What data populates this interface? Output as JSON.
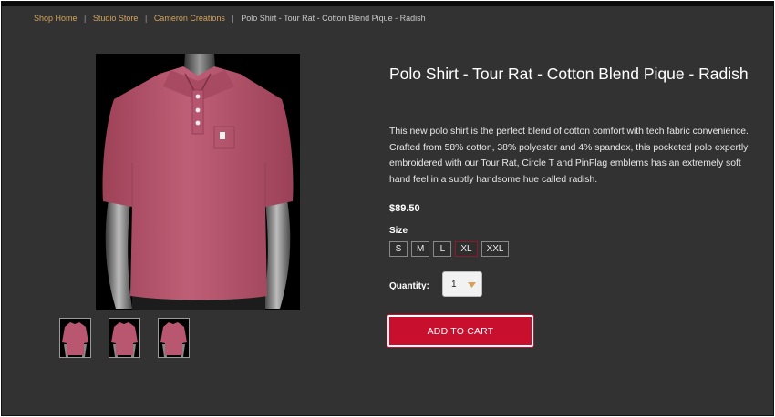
{
  "breadcrumb": {
    "items": [
      "Shop Home",
      "Studio Store",
      "Cameron Creations"
    ],
    "separator": "|",
    "current": "Polo Shirt - Tour Rat - Cotton Blend Pique - Radish"
  },
  "product": {
    "title": "Polo Shirt - Tour Rat - Cotton Blend Pique - Radish",
    "description": "This new polo shirt is the perfect blend of cotton comfort with tech fabric convenience. Crafted from 58% cotton, 38% polyester and 4% spandex, this pocketed polo expertly embroidered with our Tour Rat, Circle T and PinFlag emblems has an extremely soft hand feel in a subtly handsome hue called radish.",
    "price": "$89.50",
    "size_label": "Size",
    "sizes": [
      "S",
      "M",
      "L",
      "XL",
      "XXL"
    ],
    "quantity_label": "Quantity:",
    "quantity_value": "1",
    "add_to_cart": "ADD TO CART"
  },
  "colors": {
    "background": "#323232",
    "breadcrumb_link": "#d3a35c",
    "accent": "#c8102e",
    "shirt": "#b8576f"
  },
  "icons": {
    "quantity_dropdown": "chevron-down-icon"
  }
}
